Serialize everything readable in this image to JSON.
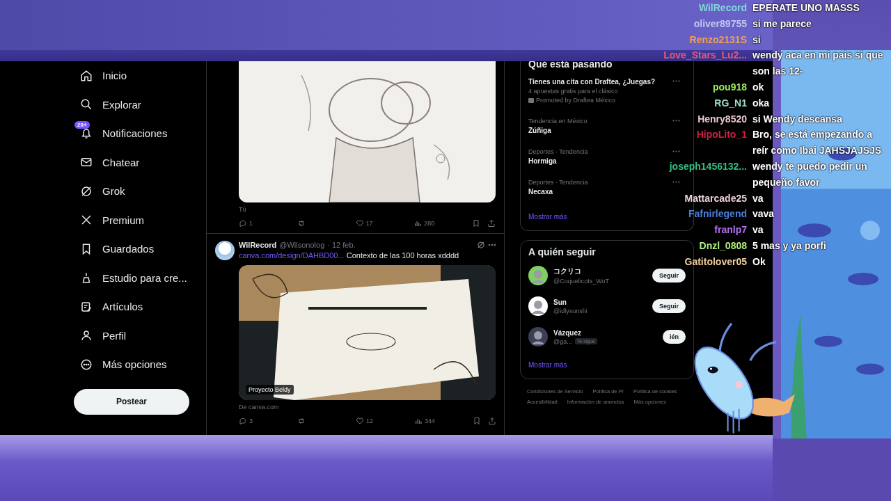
{
  "nav": {
    "items": [
      {
        "label": "Inicio"
      },
      {
        "label": "Explorar"
      },
      {
        "label": "Notificaciones",
        "badge": "20+"
      },
      {
        "label": "Chatear"
      },
      {
        "label": "Grok"
      },
      {
        "label": "Premium"
      },
      {
        "label": "Guardados"
      },
      {
        "label": "Estudio para cre..."
      },
      {
        "label": "Artículos"
      },
      {
        "label": "Perfil"
      },
      {
        "label": "Más opciones"
      }
    ],
    "post_button": "Postear"
  },
  "feed": {
    "tweets": [
      {
        "kind": "image_only",
        "caption": "Tú",
        "replies": "1",
        "likes": "17",
        "views": "280"
      },
      {
        "kind": "full",
        "author": "WilRecord",
        "handle": "@Wilsonolog",
        "date": "· 12 feb.",
        "link": "canva.com/design/DAHBD00...",
        "text": "Contexto de las 100 horas xdddd",
        "image_label": "Proyecto Beldy",
        "source": "De canva.com",
        "replies": "3",
        "likes": "12",
        "views": "344"
      }
    ]
  },
  "trends": {
    "title": "Qué está pasando",
    "items": [
      {
        "kind": "promoted",
        "title": "Tienes una cita con Draftea, ¿Juegas?",
        "subtitle": "4 apuestas gratis para el clásico",
        "promoter": "Promoted by Draftea México"
      },
      {
        "kind": "trend",
        "context": "Tendencia en México",
        "name": "Zúñiga"
      },
      {
        "kind": "trend",
        "context": "Deportes · Tendencia",
        "name": "Hormiga"
      },
      {
        "kind": "trend",
        "context": "Deportes · Tendencia",
        "name": "Necaxa"
      }
    ],
    "more": "Mostrar más"
  },
  "follow": {
    "title": "A quién seguir",
    "users": [
      {
        "name": "コクリコ",
        "handle": "@Coquelicots_WoT",
        "button": "Seguir"
      },
      {
        "name": "Sun",
        "handle": "@idlysunshi",
        "button": "Seguir"
      },
      {
        "name": "Vázquez",
        "handle": "@ga...",
        "badge": "Te sigue",
        "button": "ién"
      }
    ],
    "more": "Mostrar más"
  },
  "footer_links": [
    "Condiciones de Servicio",
    "Política de Pr",
    "Política de cookies",
    "Accesibilidad",
    "Información de anuncios",
    "Más opciones"
  ],
  "chat": [
    {
      "user": "WilRecord",
      "color": "#7fd8d8",
      "text": "EPERATE UNO MASSS"
    },
    {
      "user": "oliver89755",
      "color": "#c0c8f0",
      "text": "si me parece"
    },
    {
      "user": "Renzo2131S",
      "color": "#f0a050",
      "text": "si"
    },
    {
      "user": "Love_Stars_Lu2...",
      "color": "#e05a7a",
      "text": "wendy aca en mi pais si que son las 12-"
    },
    {
      "user": "pou918",
      "color": "#9aef5a",
      "text": "ok"
    },
    {
      "user": "RG_N1",
      "color": "#9ae0c8",
      "text": "oka"
    },
    {
      "user": "Henry8520",
      "color": "#f0c8d0",
      "text": "si Wendy descansa"
    },
    {
      "user": "HipoLito_1",
      "color": "#d02040",
      "text": "Bro, se está empezando a reír como Ibai JAHSJAJSJS"
    },
    {
      "user": "joseph1456132...",
      "color": "#30c080",
      "text": "wendy te puedo pedir un pequeño favor"
    },
    {
      "user": "Mattarcade25",
      "color": "#f0d0e0",
      "text": "va"
    },
    {
      "user": "Fafnirlegend",
      "color": "#4a80d8",
      "text": "vava"
    },
    {
      "user": "franlp7",
      "color": "#b070f0",
      "text": "va"
    },
    {
      "user": "Dnzl_0808",
      "color": "#b0f080",
      "text": "5 mas y ya porfi"
    },
    {
      "user": "Gatitolover05",
      "color": "#f0d0a0",
      "text": "Ok"
    }
  ]
}
